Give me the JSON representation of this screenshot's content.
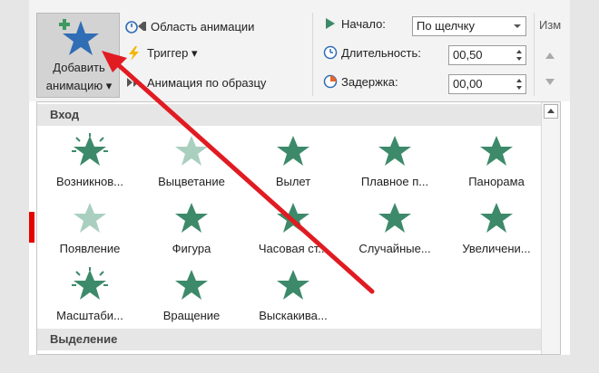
{
  "ribbon": {
    "add_animation_line1": "Добавить",
    "add_animation_line2": "анимацию ▾",
    "animation_pane": "Область анимации",
    "trigger": "Триггер ▾",
    "animation_painter": "Анимация по образцу",
    "start_label": "Начало:",
    "start_value": "По щелчку",
    "duration_label": "Длительность:",
    "duration_value": "00,50",
    "delay_label": "Задержка:",
    "delay_value": "00,00",
    "cut_off_label": "Изм"
  },
  "gallery": {
    "entrance_header": "Вход",
    "emphasis_header": "Выделение",
    "entrance_items": [
      "Возникнов...",
      "Выцветание",
      "Вылет",
      "Плавное п...",
      "Панорама",
      "Появление",
      "Фигура",
      "Часовая ст...",
      "Случайные...",
      "Увеличени...",
      "Масштаби...",
      "Вращение",
      "Выскакива..."
    ]
  },
  "colors": {
    "star": "#3d8a6a",
    "star_light": "#a9cfbf",
    "accent_blue": "#2f6db5",
    "arrow": "#e11b22"
  }
}
